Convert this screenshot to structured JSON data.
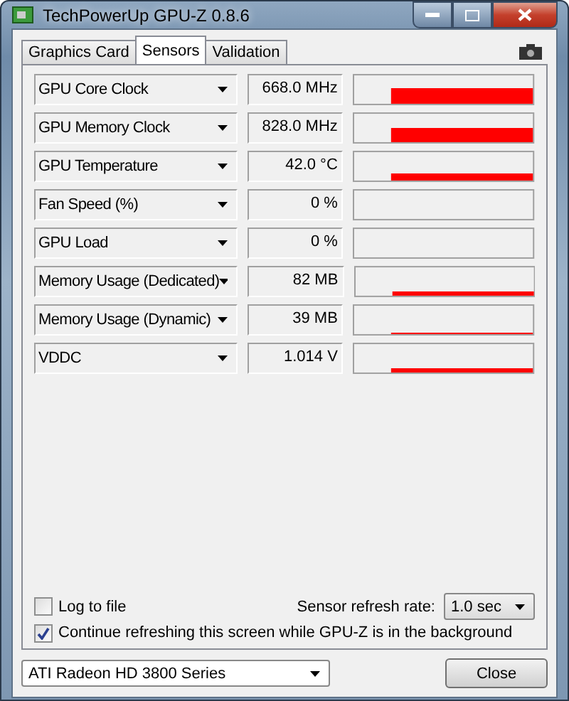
{
  "window": {
    "title": "TechPowerUp GPU-Z 0.8.6"
  },
  "tabs": [
    {
      "label": "Graphics Card",
      "selected": false
    },
    {
      "label": "Sensors",
      "selected": true
    },
    {
      "label": "Validation",
      "selected": false
    }
  ],
  "sensors": [
    {
      "name": "GPU Core Clock",
      "reading": "668.0 MHz"
    },
    {
      "name": "GPU Memory Clock",
      "reading": "828.0 MHz"
    },
    {
      "name": "GPU Temperature",
      "reading": "42.0 °C"
    },
    {
      "name": "Fan Speed (%)",
      "reading": "0 %"
    },
    {
      "name": "GPU Load",
      "reading": "0 %"
    },
    {
      "name": "Memory Usage (Dedicated)",
      "reading": "82 MB"
    },
    {
      "name": "Memory Usage (Dynamic)",
      "reading": "39 MB"
    },
    {
      "name": "VDDC",
      "reading": "1.014 V"
    }
  ],
  "log_to_file": {
    "label": "Log to file",
    "checked": false
  },
  "refresh_rate": {
    "label": "Sensor refresh rate:",
    "value": "1.0 sec"
  },
  "continue_refreshing": {
    "label": "Continue refreshing this screen while GPU-Z is in the background",
    "checked": true
  },
  "gpu_select": {
    "value": "ATI Radeon HD 3800 Series"
  },
  "close_button": "Close"
}
